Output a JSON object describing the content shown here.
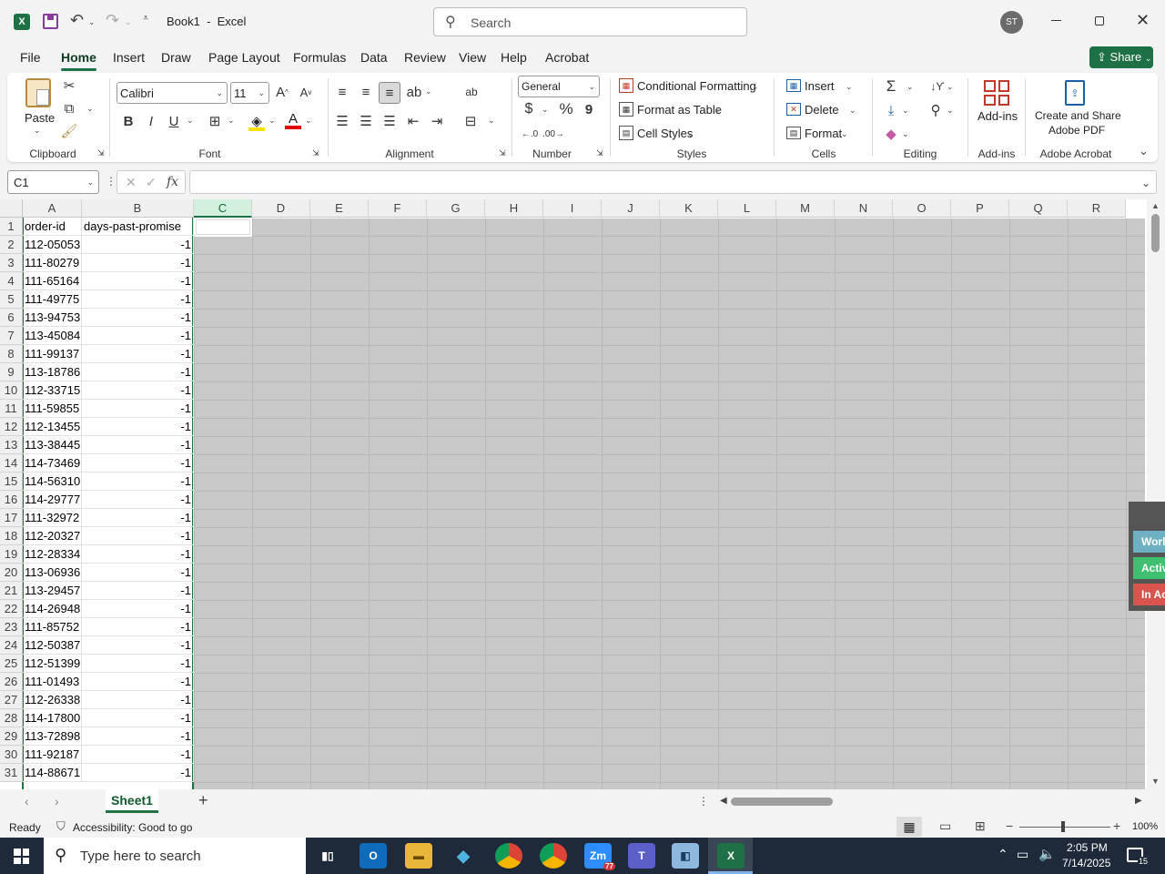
{
  "titlebar": {
    "app_icon": "excel-icon",
    "title": "Book1  -  Excel",
    "search_placeholder": "Search",
    "avatar": "ST"
  },
  "menu": [
    "File",
    "Home",
    "Insert",
    "Draw",
    "Page Layout",
    "Formulas",
    "Data",
    "Review",
    "View",
    "Help",
    "Acrobat"
  ],
  "share_label": "Share",
  "ribbon": {
    "clipboard": {
      "paste": "Paste",
      "label": "Clipboard"
    },
    "font": {
      "name": "Calibri",
      "size": "11",
      "label": "Font",
      "bold": "B",
      "italic": "I",
      "underline": "U"
    },
    "alignment": {
      "label": "Alignment"
    },
    "number": {
      "format": "General",
      "label": "Number",
      "currency": "$",
      "percent": "%",
      "comma": "9"
    },
    "styles": {
      "conditional": "Conditional Formatting",
      "format_table": "Format as Table",
      "cell_styles": "Cell Styles",
      "label": "Styles"
    },
    "cells": {
      "insert": "Insert",
      "delete": "Delete",
      "format": "Format",
      "label": "Cells"
    },
    "editing": {
      "label": "Editing"
    },
    "addins": {
      "button": "Add-ins",
      "label": "Add-ins"
    },
    "acrobat": {
      "line1": "Create and Share",
      "line2": "Adobe PDF",
      "label": "Adobe Acrobat"
    }
  },
  "formula_bar": {
    "name_box": "C1",
    "fx": "fx",
    "value": ""
  },
  "columns": [
    "A",
    "B",
    "C",
    "D",
    "E",
    "F",
    "G",
    "H",
    "I",
    "J",
    "K",
    "L",
    "M",
    "N",
    "O",
    "P",
    "Q",
    "R"
  ],
  "headers": {
    "a": "order-id",
    "b": "days-past-promise"
  },
  "rows": [
    {
      "num": "1",
      "a": "order-id",
      "b": "days-past-promise"
    },
    {
      "num": "2",
      "a": "112-05053",
      "b": "-1"
    },
    {
      "num": "3",
      "a": "111-80279",
      "b": "-1"
    },
    {
      "num": "4",
      "a": "111-65164",
      "b": "-1"
    },
    {
      "num": "5",
      "a": "111-49775",
      "b": "-1"
    },
    {
      "num": "6",
      "a": "113-94753",
      "b": "-1"
    },
    {
      "num": "7",
      "a": "113-45084",
      "b": "-1"
    },
    {
      "num": "8",
      "a": "111-99137",
      "b": "-1"
    },
    {
      "num": "9",
      "a": "113-18786",
      "b": "-1"
    },
    {
      "num": "10",
      "a": "112-33715",
      "b": "-1"
    },
    {
      "num": "11",
      "a": "111-59855",
      "b": "-1"
    },
    {
      "num": "12",
      "a": "112-13455",
      "b": "-1"
    },
    {
      "num": "13",
      "a": "113-38445",
      "b": "-1"
    },
    {
      "num": "14",
      "a": "114-73469",
      "b": "-1"
    },
    {
      "num": "15",
      "a": "114-56310",
      "b": "-1"
    },
    {
      "num": "16",
      "a": "114-29777",
      "b": "-1"
    },
    {
      "num": "17",
      "a": "111-32972",
      "b": "-1"
    },
    {
      "num": "18",
      "a": "112-20327",
      "b": "-1"
    },
    {
      "num": "19",
      "a": "112-28334",
      "b": "-1"
    },
    {
      "num": "20",
      "a": "113-06936",
      "b": "-1"
    },
    {
      "num": "21",
      "a": "113-29457",
      "b": "-1"
    },
    {
      "num": "22",
      "a": "114-26948",
      "b": "-1"
    },
    {
      "num": "23",
      "a": "111-85752",
      "b": "-1"
    },
    {
      "num": "24",
      "a": "112-50387",
      "b": "-1"
    },
    {
      "num": "25",
      "a": "112-51399",
      "b": "-1"
    },
    {
      "num": "26",
      "a": "111-01493",
      "b": "-1"
    },
    {
      "num": "27",
      "a": "112-26338",
      "b": "-1"
    },
    {
      "num": "28",
      "a": "114-17800",
      "b": "-1"
    },
    {
      "num": "29",
      "a": "113-72898",
      "b": "-1"
    },
    {
      "num": "30",
      "a": "111-92187",
      "b": "-1"
    },
    {
      "num": "31",
      "a": "114-88671",
      "b": "-1"
    }
  ],
  "side_panel": [
    "Worl",
    "Activ",
    "In Ac"
  ],
  "sheet_tab": "Sheet1",
  "status": {
    "ready": "Ready",
    "accessibility": "Accessibility: Good to go",
    "zoom": "100%"
  },
  "taskbar": {
    "search_placeholder": "Type here to search",
    "time": "2:05 PM",
    "date": "7/14/2025",
    "zoom_badge": "77",
    "notif_count": "15"
  }
}
